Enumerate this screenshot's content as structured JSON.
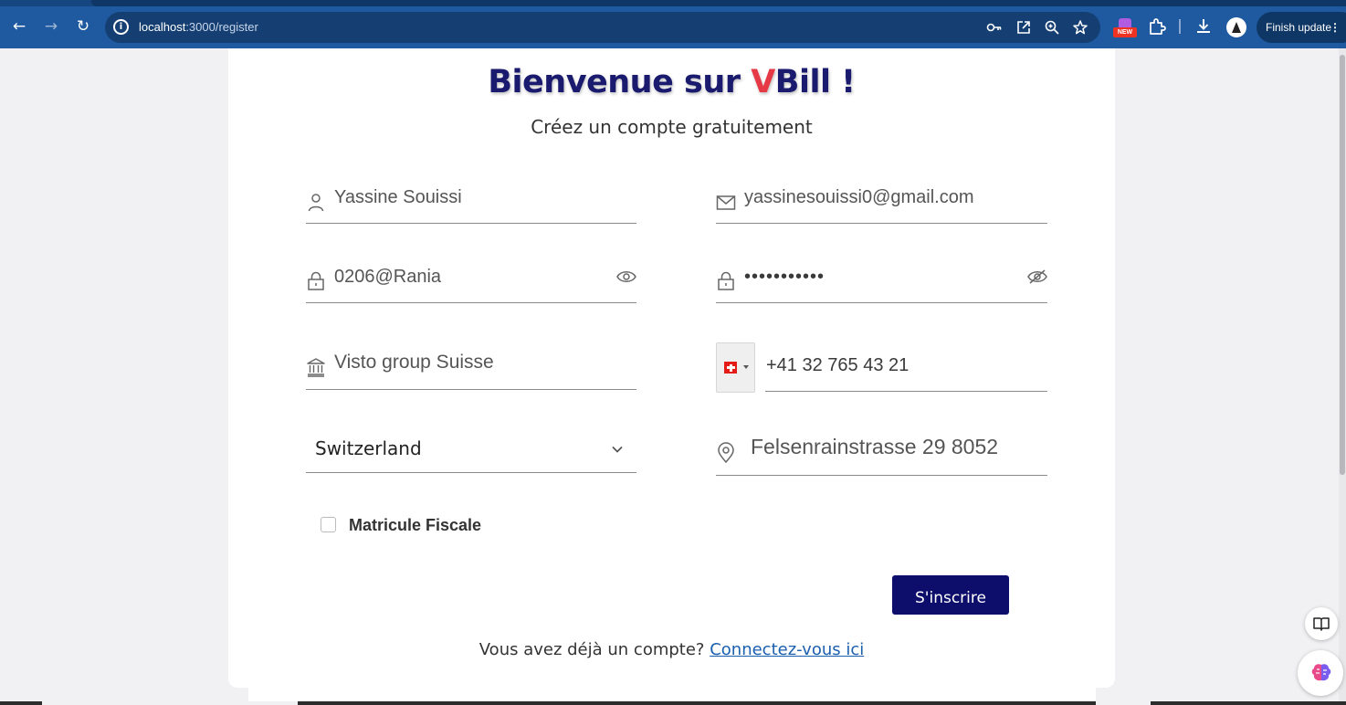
{
  "browser": {
    "url_host": "localhost",
    "url_path": ":3000/register",
    "finish_update_label": "Finish update",
    "new_badge": "NEW"
  },
  "page": {
    "title_prefix": "Bienvenue sur ",
    "title_brand_v": "V",
    "title_brand_rest": "Bill !",
    "subtitle": "Créez un compte gratuitement"
  },
  "form": {
    "name_value": "Yassine Souissi",
    "email_value": "yassinesouissi0@gmail.com",
    "password_value": "0206@Rania",
    "confirm_password_value": "•••••••••••",
    "company_value": "Visto group Suisse",
    "phone_value": "+41 32 765 43 21",
    "country_value": "Switzerland",
    "address_value": "Felsenrainstrasse 29 8052",
    "matricule_label": "Matricule Fiscale",
    "matricule_checked": false,
    "submit_label": "S'inscrire"
  },
  "footer": {
    "text": "Vous avez déjà un compte? ",
    "link": "Connectez-vous ici"
  },
  "colors": {
    "brand_navy": "#1a1a6e",
    "brand_red": "#e63946",
    "button_bg": "#0d0d6b",
    "link": "#1b5fb0",
    "chrome": "#1f5aa0"
  }
}
